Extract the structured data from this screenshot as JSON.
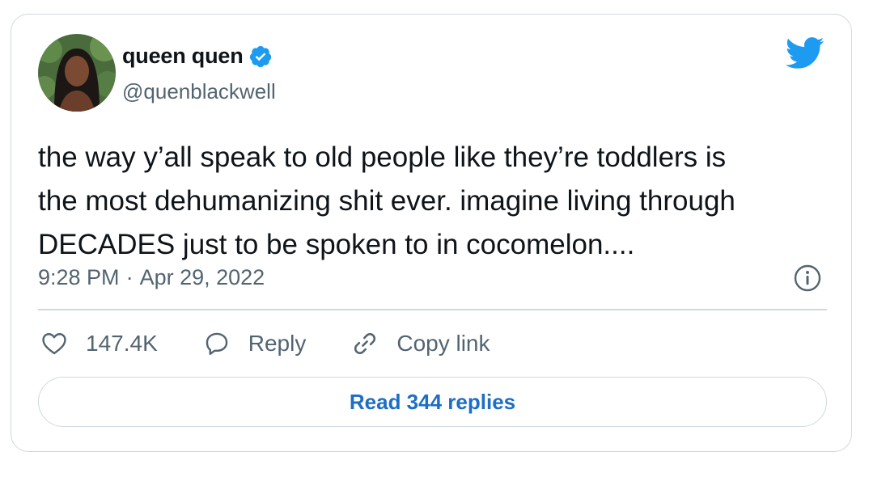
{
  "author": {
    "name": "queen quen",
    "handle": "@quenblackwell",
    "verified": true,
    "avatar_icon": "profile-photo"
  },
  "tweet": {
    "text": "the way y’all speak to old people like they’re toddlers is\nthe most dehumanizing shit ever. imagine living through\nDECADES just to be spoken to in cocomelon....",
    "time": "9:28 PM",
    "separator": "·",
    "date": "Apr 29, 2022"
  },
  "actions": {
    "likes": "147.4K",
    "reply_label": "Reply",
    "copy_link_label": "Copy link"
  },
  "read_replies_label": "Read 344 replies",
  "colors": {
    "brand_blue": "#1d9bf0",
    "link_blue": "#1d6ec5",
    "muted_text": "#536471",
    "border": "#cfd9de"
  },
  "icons": [
    "verified-badge-icon",
    "twitter-bird-icon",
    "info-icon",
    "heart-icon",
    "reply-bubble-icon",
    "link-icon"
  ]
}
